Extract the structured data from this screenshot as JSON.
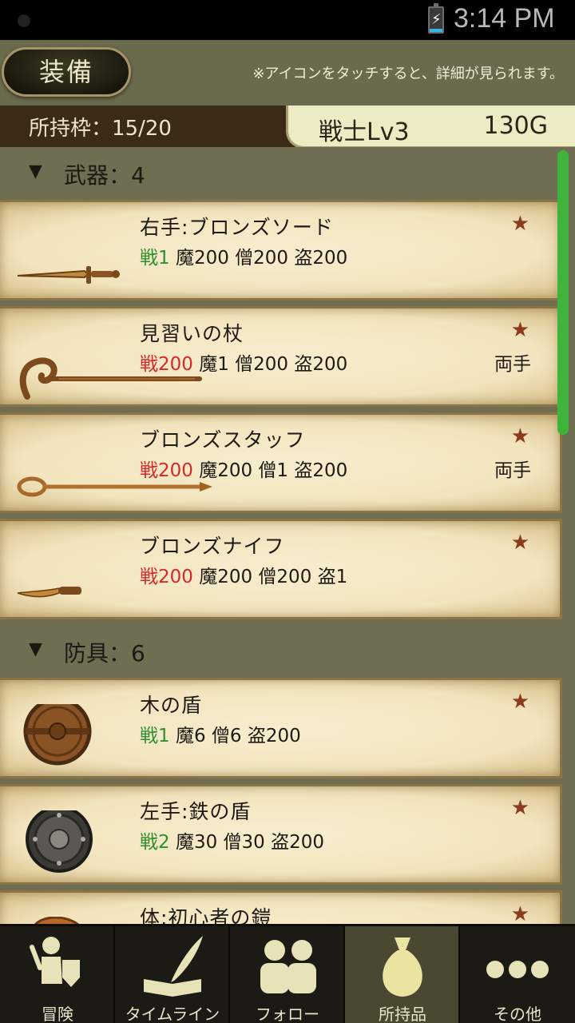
{
  "status_bar": {
    "time": "3:14 PM"
  },
  "header": {
    "equip_button": "装備",
    "hint": "※アイコンをタッチすると、詳細が見られます。"
  },
  "capacity": {
    "label": "所持枠：15/20"
  },
  "character": {
    "job_level": "戦士Lv3",
    "gold": "130G"
  },
  "sections": [
    {
      "title": "武器：4"
    },
    {
      "title": "防具：6"
    }
  ],
  "items": [
    {
      "name": "右手:ブロンズソード",
      "first": "戦1",
      "rest": " 魔200 僧200 盗200",
      "first_color": "green",
      "star": "★",
      "hand": ""
    },
    {
      "name": "見習いの杖",
      "first": "戦200",
      "rest": " 魔1 僧200 盗200",
      "first_color": "red",
      "star": "★",
      "hand": "両手"
    },
    {
      "name": "ブロンズスタッフ",
      "first": "戦200",
      "rest": " 魔200 僧1 盗200",
      "first_color": "red",
      "star": "★",
      "hand": "両手"
    },
    {
      "name": "ブロンズナイフ",
      "first": "戦200",
      "rest": " 魔200 僧200 盗1",
      "first_color": "red",
      "star": "★",
      "hand": ""
    },
    {
      "name": "木の盾",
      "first": "戦1",
      "rest": " 魔6 僧6 盗200",
      "first_color": "green",
      "star": "★",
      "hand": ""
    },
    {
      "name": "左手:鉄の盾",
      "first": "戦2",
      "rest": " 魔30 僧30 盗200",
      "first_color": "green",
      "star": "★",
      "hand": ""
    },
    {
      "name": "体:初心者の鎧",
      "first": "",
      "rest": "",
      "first_color": "green",
      "star": "★",
      "hand": ""
    }
  ],
  "nav": [
    {
      "label": "冒険",
      "icon": "adventurer-icon"
    },
    {
      "label": "タイムライン",
      "icon": "quill-book-icon"
    },
    {
      "label": "フォロー",
      "icon": "people-icon"
    },
    {
      "label": "所持品",
      "icon": "bag-icon",
      "active": true
    },
    {
      "label": "その他",
      "icon": "more-dots-icon"
    }
  ],
  "colors": {
    "accent_green": "#3fb33a",
    "stat_red": "#d62a2a",
    "stat_green": "#2f8f2f",
    "star": "#8a3c1c"
  }
}
